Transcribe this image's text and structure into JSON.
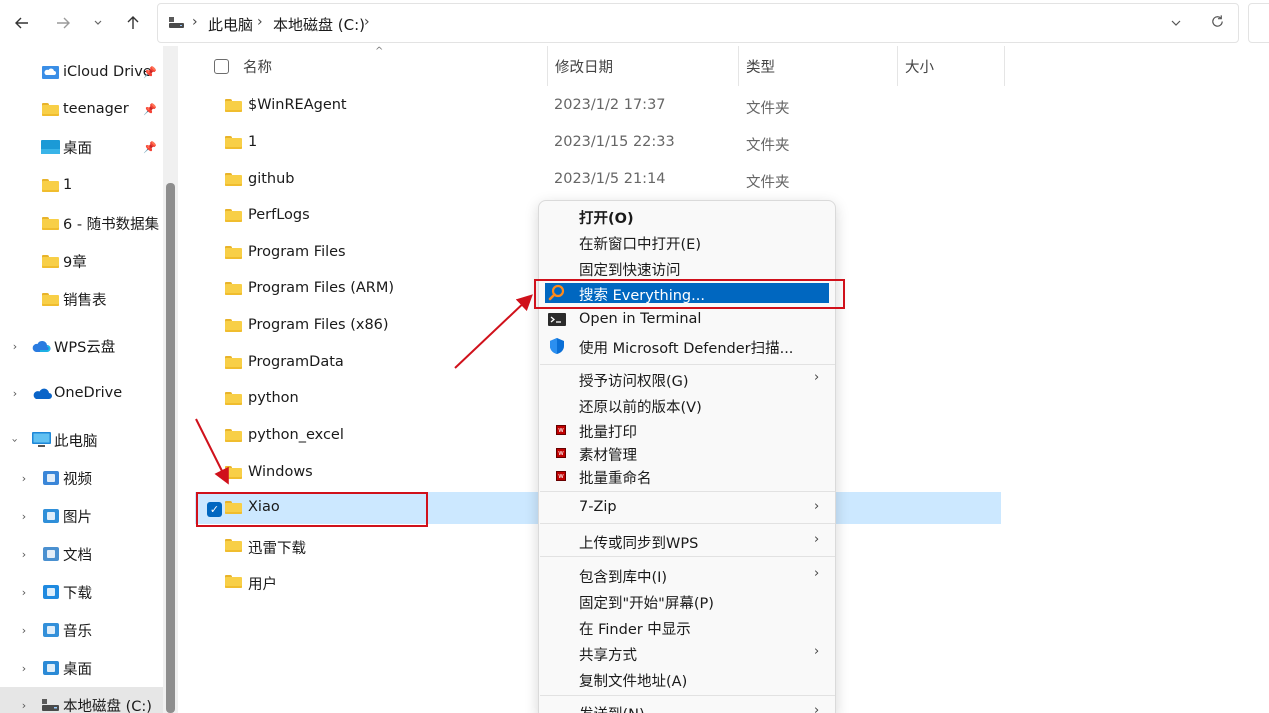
{
  "address_bar": {
    "breadcrumbs": [
      "此电脑",
      "本地磁盘 (C:)"
    ]
  },
  "nav_pane": {
    "items": [
      {
        "label": "iCloud Drive",
        "icon": "icloud-drive-icon",
        "pinned": true
      },
      {
        "label": "teenager",
        "icon": "folder-icon",
        "pinned": true
      },
      {
        "label": "桌面",
        "icon": "desktop-icon",
        "pinned": true
      },
      {
        "label": "1",
        "icon": "folder-icon",
        "pinned": false
      },
      {
        "label": "6 - 随书数据集",
        "icon": "folder-icon",
        "pinned": false
      },
      {
        "label": "9章",
        "icon": "folder-icon",
        "pinned": false
      },
      {
        "label": "销售表",
        "icon": "folder-icon",
        "pinned": false
      },
      {
        "label": "WPS云盘",
        "icon": "wps-cloud-icon",
        "expandable": true
      },
      {
        "label": "OneDrive",
        "icon": "onedrive-icon",
        "expandable": true
      },
      {
        "label": "此电脑",
        "icon": "this-pc-icon",
        "expanded": true
      },
      {
        "label": "视频",
        "icon": "videos-icon",
        "expandable": true
      },
      {
        "label": "图片",
        "icon": "pictures-icon",
        "expandable": true
      },
      {
        "label": "文档",
        "icon": "documents-icon",
        "expandable": true
      },
      {
        "label": "下载",
        "icon": "downloads-icon",
        "expandable": true
      },
      {
        "label": "音乐",
        "icon": "music-icon",
        "expandable": true
      },
      {
        "label": "桌面",
        "icon": "desktop-icon",
        "expandable": true
      },
      {
        "label": "本地磁盘 (C:)",
        "icon": "drive-icon",
        "expandable": true,
        "selected": true
      }
    ]
  },
  "file_list": {
    "columns": [
      "名称",
      "修改日期",
      "类型",
      "大小"
    ],
    "rows": [
      {
        "name": "$WinREAgent",
        "date": "2023/1/2 17:37",
        "type": "文件夹"
      },
      {
        "name": "1",
        "date": "2023/1/15 22:33",
        "type": "文件夹"
      },
      {
        "name": "github",
        "date": "2023/1/5 21:14",
        "type": "文件夹"
      },
      {
        "name": "PerfLogs",
        "date": "",
        "type": ""
      },
      {
        "name": "Program Files",
        "date": "",
        "type": ""
      },
      {
        "name": "Program Files (ARM)",
        "date": "",
        "type": ""
      },
      {
        "name": "Program Files (x86)",
        "date": "",
        "type": ""
      },
      {
        "name": "ProgramData",
        "date": "",
        "type": ""
      },
      {
        "name": "python",
        "date": "",
        "type": ""
      },
      {
        "name": "python_excel",
        "date": "",
        "type": ""
      },
      {
        "name": "Windows",
        "date": "",
        "type": ""
      },
      {
        "name": "Xiao",
        "date": "",
        "type": "",
        "selected": true
      },
      {
        "name": "迅雷下载",
        "date": "",
        "type": ""
      },
      {
        "name": "用户",
        "date": "",
        "type": ""
      }
    ]
  },
  "context_menu": {
    "items": [
      {
        "label": "打开(O)",
        "bold": true
      },
      {
        "label": "在新窗口中打开(E)"
      },
      {
        "label": "固定到快速访问"
      },
      {
        "label": "搜索 Everything...",
        "icon": "everything-search-icon",
        "highlighted": true
      },
      {
        "label": "Open in Terminal",
        "icon": "terminal-icon"
      },
      {
        "label": "使用 Microsoft Defender扫描...",
        "icon": "defender-shield-icon"
      },
      {
        "label": "授予访问权限(G)",
        "submenu": true
      },
      {
        "label": "还原以前的版本(V)"
      },
      {
        "label": "批量打印",
        "icon": "batch-tool-icon"
      },
      {
        "label": "素材管理",
        "icon": "batch-tool-icon"
      },
      {
        "label": "批量重命名",
        "icon": "batch-tool-icon"
      },
      {
        "label": "7-Zip",
        "submenu": true
      },
      {
        "label": "上传或同步到WPS",
        "submenu": true
      },
      {
        "label": "包含到库中(I)",
        "submenu": true
      },
      {
        "label": "固定到\"开始\"屏幕(P)"
      },
      {
        "label": "在 Finder 中显示"
      },
      {
        "label": "共享方式",
        "submenu": true
      },
      {
        "label": "复制文件地址(A)"
      },
      {
        "label": "发送到(N)",
        "submenu": true
      }
    ]
  },
  "colors": {
    "selection": "#cce8ff",
    "menu_highlight": "#0067c0",
    "annotation_red": "#d0111b",
    "folder": "#f8cf47"
  }
}
